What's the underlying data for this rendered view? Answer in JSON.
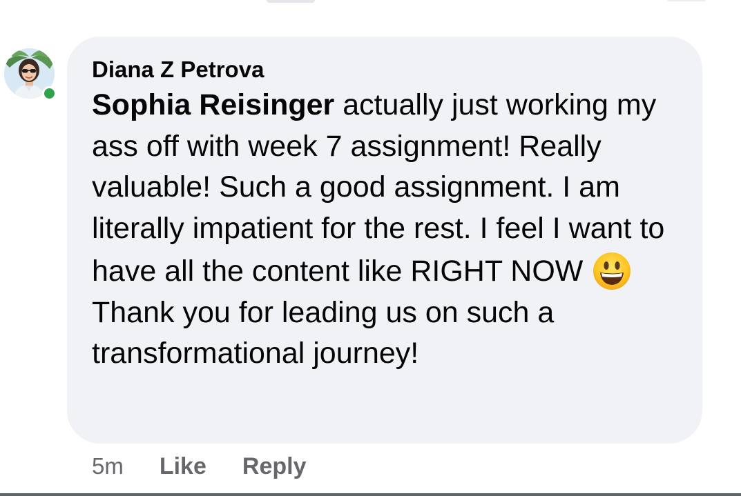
{
  "comment": {
    "author_name": "Diana Z Petrova",
    "mention_name": "Sophia Reisinger",
    "text_part1": " actually just working my ass off with week 7 assignment! Really valuable! Such a good assignment. I am literally impatient for the rest. I feel I want to have all the content like RIGHT NOW ",
    "emoji_icon": "grinning-face-emoji",
    "text_part2": " Thank you for leading us on such a transformational journey!",
    "timestamp": "5m",
    "like_label": "Like",
    "reply_label": "Reply",
    "online_status_color": "#31a24c"
  },
  "colors": {
    "bubble_background": "#f0f2f5",
    "primary_text": "#050505",
    "secondary_text": "#65676b"
  }
}
